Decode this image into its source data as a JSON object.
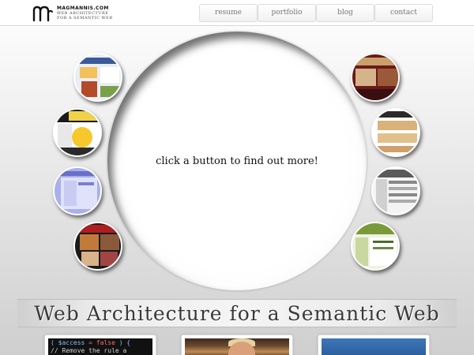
{
  "header": {
    "logo": {
      "domain": "MAGMANNIS.COM",
      "tagline_line1": "WEB ARCHITECTURE",
      "tagline_line2": "FOR A SEMANTIC WEB"
    },
    "nav": [
      {
        "label": "resume"
      },
      {
        "label": "portfolio"
      },
      {
        "label": "blog"
      },
      {
        "label": "contact"
      }
    ]
  },
  "main": {
    "prompt": "click a button to find out more!"
  },
  "banner": {
    "title": "Web Architecture for a Semantic Web"
  },
  "code_snippet": {
    "line1_var": "$access",
    "line1_op": " = ",
    "line1_kw": "false",
    "line1_rest": " ) {",
    "line2": "// Remove the rule a"
  },
  "colors": {
    "nav_text": "#777777",
    "banner_text": "#3a3a3a",
    "circle_bg": "#ffffff"
  }
}
